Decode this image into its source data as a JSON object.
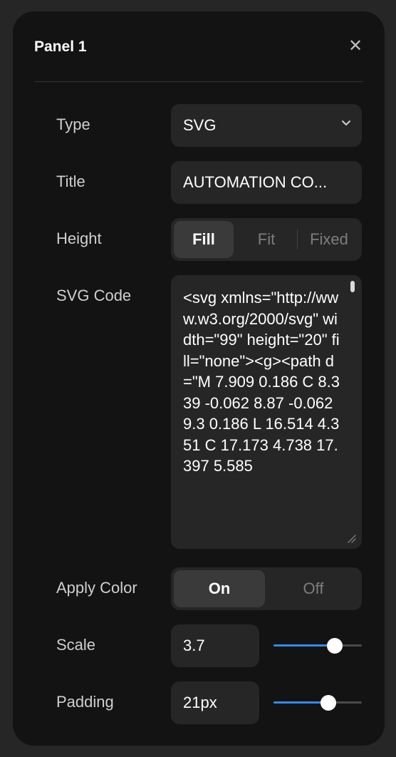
{
  "panel": {
    "title": "Panel 1",
    "close_icon": "close-icon"
  },
  "fields": {
    "type": {
      "label": "Type",
      "value": "SVG",
      "icon": "chevron-down-icon"
    },
    "title": {
      "label": "Title",
      "value": "AUTOMATION CO..."
    },
    "height": {
      "label": "Height",
      "options": [
        "Fill",
        "Fit",
        "Fixed"
      ],
      "selected": "Fill"
    },
    "svg_code": {
      "label": "SVG Code",
      "value": "<svg xmlns=\"http://www.w3.org/2000/svg\" width=\"99\" height=\"20\" fill=\"none\"><g><path d=\"M 7.909 0.186 C 8.339 -0.062 8.87 -0.062 9.3 0.186 L 16.514 4.351 C 17.173 4.738 17.397 5.585"
    },
    "apply_color": {
      "label": "Apply Color",
      "options": [
        "On",
        "Off"
      ],
      "selected": "On"
    },
    "scale": {
      "label": "Scale",
      "value": "3.7",
      "slider_fraction": 0.69
    },
    "padding": {
      "label": "Padding",
      "value": "21px",
      "slider_fraction": 0.62
    }
  },
  "colors": {
    "accent": "#2f8cf5",
    "panel_bg": "#131313",
    "field_bg": "#262626"
  }
}
